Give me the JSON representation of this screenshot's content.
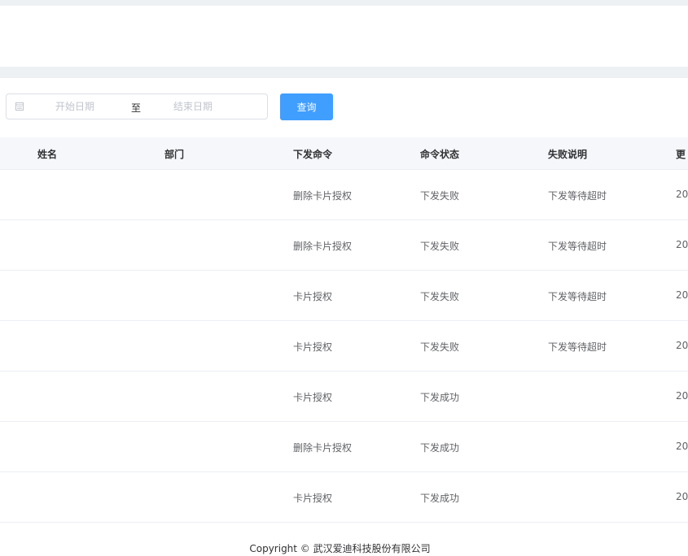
{
  "filter": {
    "start_placeholder": "开始日期",
    "separator": "至",
    "end_placeholder": "结束日期",
    "query_label": "查询"
  },
  "table": {
    "columns": [
      "姓名",
      "部门",
      "下发命令",
      "命令状态",
      "失败说明",
      "更"
    ],
    "rows": [
      {
        "name": "",
        "dept": "",
        "command": "删除卡片授权",
        "status": "下发失败",
        "reason": "下发等待超时",
        "updated": "20"
      },
      {
        "name": "",
        "dept": "",
        "command": "删除卡片授权",
        "status": "下发失败",
        "reason": "下发等待超时",
        "updated": "20"
      },
      {
        "name": "",
        "dept": "",
        "command": "卡片授权",
        "status": "下发失败",
        "reason": "下发等待超时",
        "updated": "20"
      },
      {
        "name": "",
        "dept": "",
        "command": "卡片授权",
        "status": "下发失败",
        "reason": "下发等待超时",
        "updated": "20"
      },
      {
        "name": "",
        "dept": "",
        "command": "卡片授权",
        "status": "下发成功",
        "reason": "",
        "updated": "20"
      },
      {
        "name": "",
        "dept": "",
        "command": "删除卡片授权",
        "status": "下发成功",
        "reason": "",
        "updated": "20"
      },
      {
        "name": "",
        "dept": "",
        "command": "卡片授权",
        "status": "下发成功",
        "reason": "",
        "updated": "20"
      }
    ]
  },
  "footer": {
    "copyright": "Copyright © 武汉爱迪科技股份有限公司"
  },
  "colors": {
    "primary": "#409eff",
    "header_bg": "#f5f7fa",
    "border": "#ebeef5"
  },
  "icons": {
    "date": "calendar-icon"
  }
}
